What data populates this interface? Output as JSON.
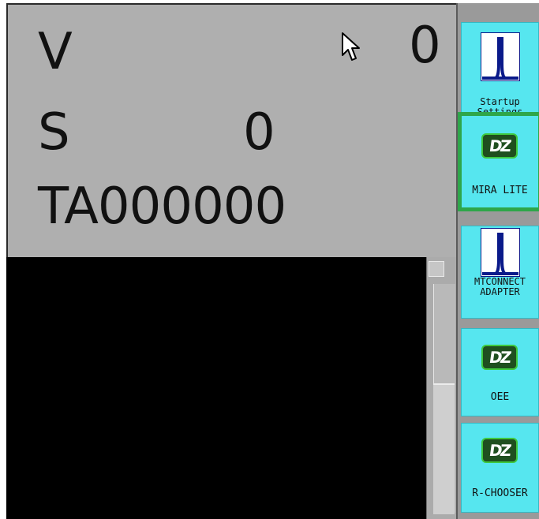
{
  "readout": {
    "v_label": "V",
    "v_value": "0",
    "s_label": "S",
    "s_value": "0",
    "ta_value": "TA000000"
  },
  "palette": {
    "apps": [
      {
        "name": "Startup\nSettings",
        "icon": "tuner-icon"
      },
      {
        "name": "MIRA LITE",
        "icon": "dz-logo-icon",
        "selected": true
      },
      {
        "name": "MTCONNECT\nADAPTER",
        "icon": "tuner-icon"
      },
      {
        "name": "OEE",
        "icon": "dz-logo-icon"
      },
      {
        "name": "R-CHOOSER",
        "icon": "dz-logo-icon"
      }
    ],
    "dz_text": "DZ",
    "accent_cyan": "#56e6ef",
    "selection_green": "#2ea64a"
  },
  "colors": {
    "readout_bg": "#afafaf",
    "black_area": "#000000",
    "scrollbar": "#ababab"
  }
}
